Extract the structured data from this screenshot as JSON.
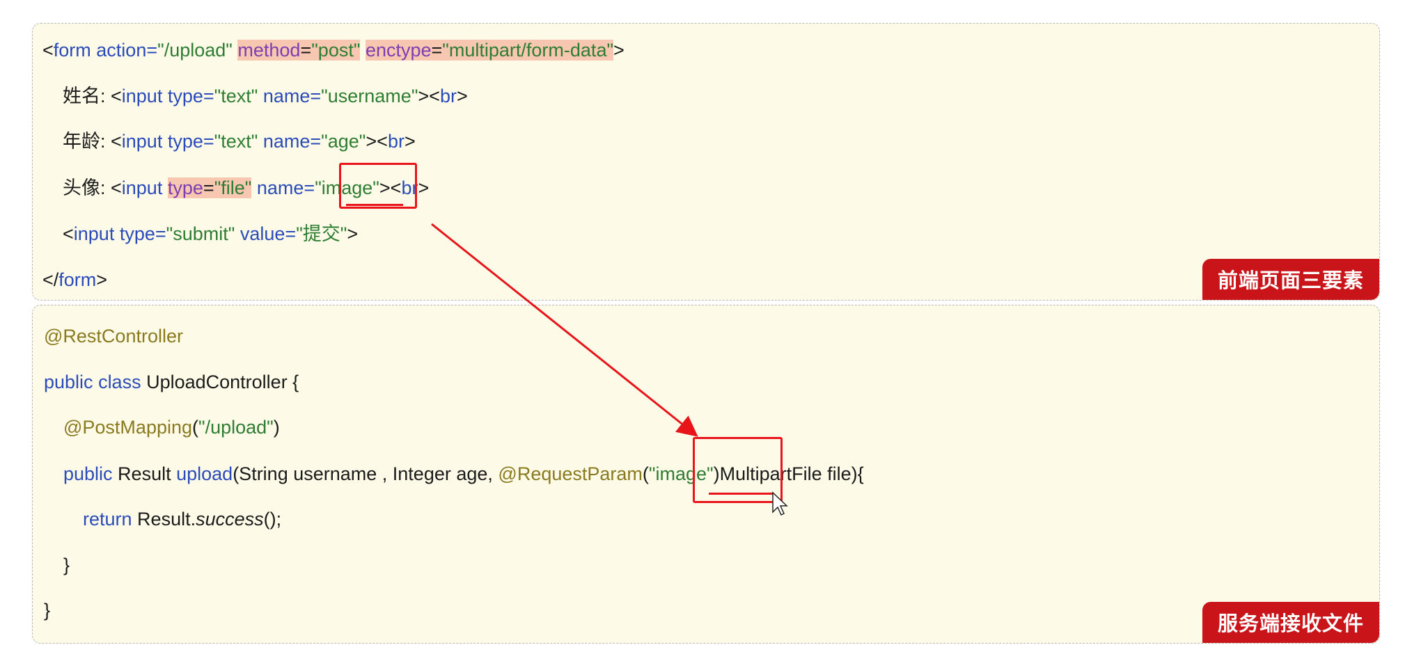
{
  "frontend": {
    "lines": [
      {
        "parts": [
          "<",
          "form",
          " action=",
          "\"/upload\"",
          " ",
          "method",
          "=",
          "\"post\"",
          " ",
          "enctype",
          "=",
          "\"multipart/form-data\"",
          ">"
        ]
      },
      {
        "parts": [
          "姓名: <",
          "input",
          " type=",
          "\"text\"",
          " name=",
          "\"username\"",
          "><",
          "br",
          ">"
        ]
      },
      {
        "parts": [
          "年龄: <",
          "input",
          " type=",
          "\"text\"",
          " name=",
          "\"age\"",
          "><",
          "br",
          ">"
        ]
      },
      {
        "parts": [
          "头像: <",
          "input",
          " ",
          "type",
          "=",
          "\"file\"",
          " name=",
          "\"image\"",
          "><",
          "br",
          ">"
        ]
      },
      {
        "parts": [
          "<",
          "input",
          " type=",
          "\"submit\"",
          " value=",
          "\"提交\"",
          ">"
        ]
      },
      {
        "parts": [
          "</",
          "form",
          ">"
        ]
      }
    ],
    "badge": "前端页面三要素"
  },
  "backend": {
    "lines": [
      {
        "parts": [
          "@RestController"
        ]
      },
      {
        "parts": [
          "public",
          " ",
          "class",
          " UploadController {"
        ]
      },
      {
        "parts": [
          "@PostMapping",
          "(",
          "\"/upload\"",
          ")"
        ]
      },
      {
        "parts": [
          "public",
          " Result ",
          "upload",
          "(String username , Integer age, ",
          "@RequestParam",
          "(",
          "\"image\"",
          ")",
          "MultipartFile file){"
        ]
      },
      {
        "parts": [
          "return",
          " Result.",
          "success",
          "();"
        ]
      },
      {
        "parts": [
          "}"
        ]
      },
      {
        "parts": [
          "}"
        ]
      }
    ],
    "badge": "服务端接收文件"
  },
  "colors": {
    "panel_bg": "#fdfbe8",
    "keyword": "#2a4bb8",
    "string": "#2e7d32",
    "annotation": "#8a7a1f",
    "highlight": "#f7c7b2",
    "badge_bg": "#c9141a",
    "annotation_red": "#e8141a"
  }
}
